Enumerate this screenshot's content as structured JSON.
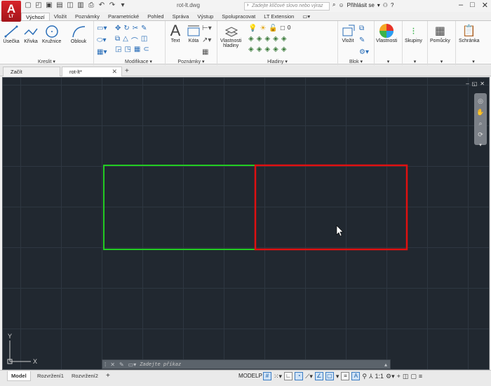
{
  "app": {
    "logo_main": "A",
    "logo_sub": "LT",
    "document_title": "rot-lt.dwg",
    "search_placeholder": "Zadejte klíčové slovo nebo výraz",
    "sign_in": "Přihlásit se",
    "help_icon": "question-icon"
  },
  "ribbon_tabs": [
    {
      "label": "Výchozí",
      "active": true
    },
    {
      "label": "Vložit"
    },
    {
      "label": "Poznámky"
    },
    {
      "label": "Parametrické"
    },
    {
      "label": "Pohled"
    },
    {
      "label": "Správa"
    },
    {
      "label": "Výstup"
    },
    {
      "label": "Spolupracovat"
    },
    {
      "label": "LT Extension"
    }
  ],
  "ribbon": {
    "groups": {
      "kreslit": "Kreslit ▾",
      "modifikace": "Modifikace ▾",
      "poznamky": "Poznámky ▾",
      "hladiny": "Hladiny ▾",
      "blok": "Blok ▾"
    },
    "tools": {
      "usecka": "Úsečka",
      "krivka": "Křivka",
      "kruznice": "Kružnice",
      "oblouk": "Oblouk",
      "text": "Text",
      "kota": "Kóta",
      "vlastnosti_hladiny_1": "Vlastnosti",
      "vlastnosti_hladiny_2": "hladiny",
      "layer_value": "0",
      "vlozit": "Vložit",
      "vlastnosti": "Vlastnosti",
      "skupiny": "Skupiny",
      "pomucky": "Pomůcky",
      "schranka": "Schránka"
    }
  },
  "document_tabs": [
    {
      "label": "Začít"
    },
    {
      "label": "rot-lt*",
      "closable": true
    }
  ],
  "canvas": {
    "background": "#212830",
    "rect_left_color": "#22cc22",
    "rect_right_color": "#e01010",
    "ucs_y": "Y",
    "ucs_x": "X"
  },
  "command_line": {
    "placeholder": "Zadejte příkaz"
  },
  "status_bar": {
    "layout_tabs": [
      {
        "label": "Model",
        "active": true
      },
      {
        "label": "Rozvržení1"
      },
      {
        "label": "Rozvržení2"
      }
    ],
    "mode": "MODELP",
    "scale": "1:1"
  }
}
